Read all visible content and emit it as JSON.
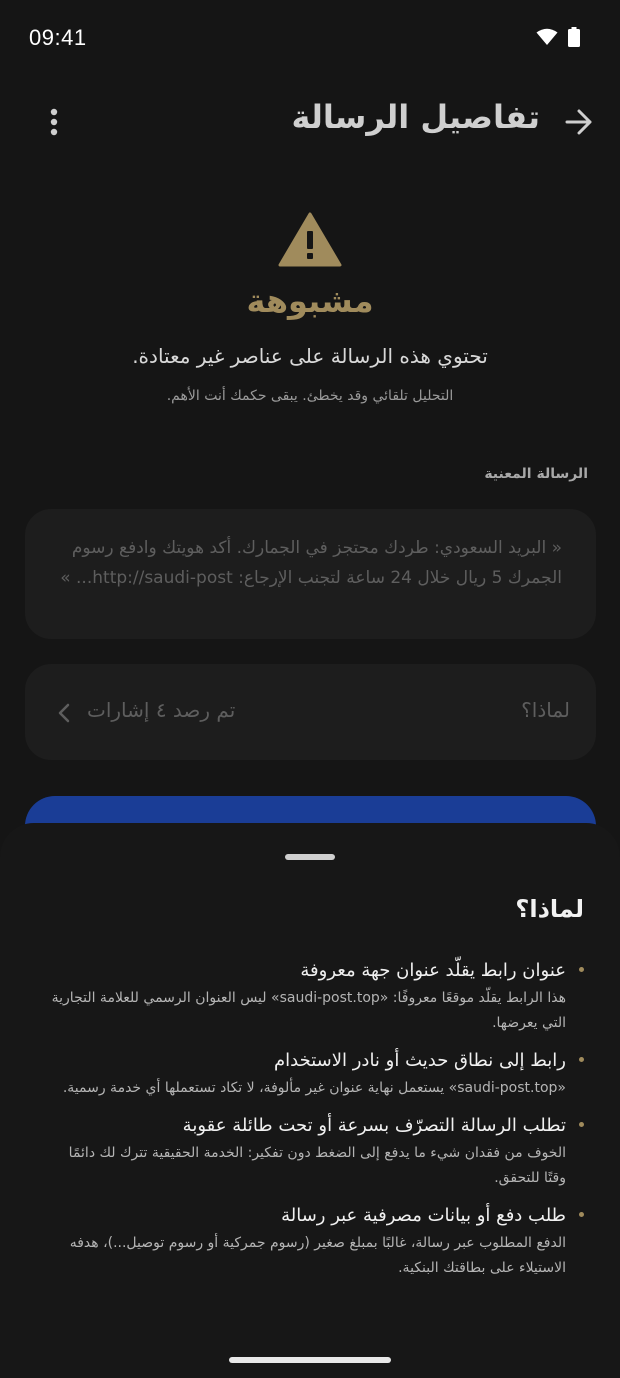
{
  "status_bar": {
    "time": "09:41"
  },
  "header": {
    "title": "تفاصيل الرسالة"
  },
  "verdict": {
    "label": "مشبوهة",
    "description": "تحتوي هذه الرسالة على عناصر غير معتادة.",
    "note": "التحليل تلقائي وقد يخطئ. يبقى حكمك أنت الأهم."
  },
  "message_section": {
    "label": "الرسالة المعنية",
    "text": "« البريد السعودي: طردك محتجز في الجمارك. أكد هويتك وادفع رسوم الجمرك 5 ريال خلال 24 ساعة لتجنب الإرجاع: http://saudi-post... »"
  },
  "why_row": {
    "label": "لماذا؟",
    "count": "تم رصد ٤ إشارات"
  },
  "sheet": {
    "title": "لماذا؟",
    "reasons": [
      {
        "title": "عنوان رابط يقلّد عنوان جهة معروفة",
        "description": "هذا الرابط يقلّد موقعًا معروفًا: «saudi-post.top» ليس العنوان الرسمي للعلامة التجارية التي يعرضها."
      },
      {
        "title": "رابط إلى نطاق حديث أو نادر الاستخدام",
        "description": "«saudi-post.top» يستعمل نهاية عنوان غير مألوفة، لا تكاد تستعملها أي خدمة رسمية."
      },
      {
        "title": "تطلب الرسالة التصرّف بسرعة أو تحت طائلة عقوبة",
        "description": "الخوف من فقدان شيء ما يدفع إلى الضغط دون تفكير: الخدمة الحقيقية تترك لك دائمًا وقتًا للتحقق."
      },
      {
        "title": "طلب دفع أو بيانات مصرفية عبر رسالة",
        "description": "الدفع المطلوب عبر رسالة، غالبًا بمبلغ صغير (رسوم جمركية أو رسوم توصيل...)، هدفه الاستيلاء على بطاقتك البنكية."
      }
    ]
  },
  "icons": {
    "wifi": "wifi-icon",
    "battery": "battery-icon",
    "back": "arrow-right-icon",
    "menu": "more-vert-icon",
    "warning": "warning-triangle-icon",
    "chevron": "chevron-left-icon"
  },
  "colors": {
    "background": "#151515",
    "card": "#1d1d1d",
    "sheet": "#171717",
    "warning_gold": "#a08b5c",
    "primary_blue": "#1a3d96"
  }
}
